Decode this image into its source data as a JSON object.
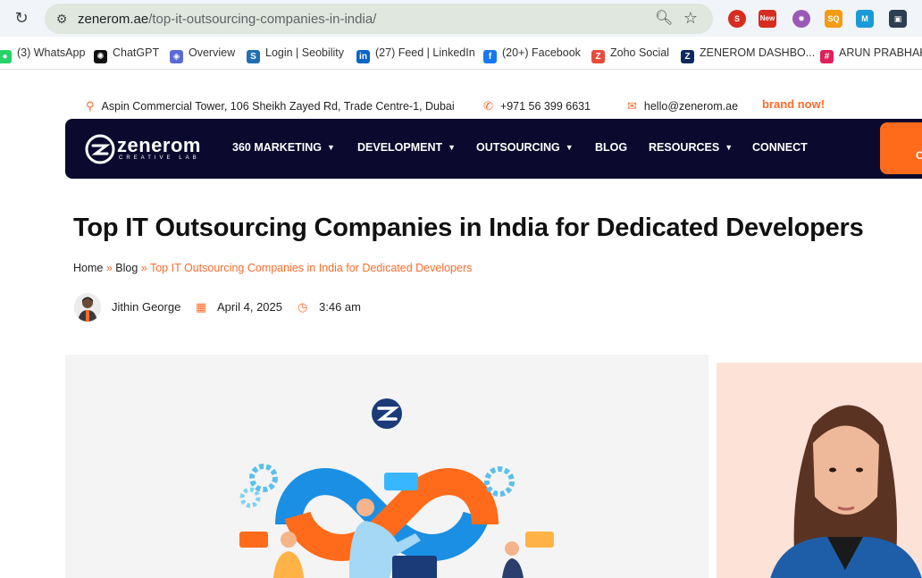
{
  "browser": {
    "url_host": "zenerom.ae",
    "url_path": "/top-it-outsourcing-companies-in-india/",
    "extensions": [
      {
        "name": "seo-extension-icon",
        "label": "SEO",
        "color": "#d62d20"
      },
      {
        "name": "new-extension-icon",
        "label": "New",
        "color": "#d62d20"
      },
      {
        "name": "gear-extension-icon",
        "label": "",
        "color": "#9b59b6"
      },
      {
        "name": "seoquake-extension-icon",
        "label": "SQ",
        "color": "#f39c12"
      },
      {
        "name": "m-extension-icon",
        "label": "M",
        "color": "#1a9bd7"
      },
      {
        "name": "puzzle-extension-icon",
        "label": "",
        "color": "#2c3e50"
      }
    ]
  },
  "bookmarks": [
    {
      "label": "(3) WhatsApp",
      "icon": "whatsapp-icon",
      "color": "#25d366",
      "glyph": "●"
    },
    {
      "label": "ChatGPT",
      "icon": "chatgpt-icon",
      "color": "#111111",
      "glyph": "✺"
    },
    {
      "label": "Overview",
      "icon": "overview-icon",
      "color": "#5b6bd6",
      "glyph": "◈"
    },
    {
      "label": "Login | Seobility",
      "icon": "seobility-icon",
      "color": "#1f6fb5",
      "glyph": "S"
    },
    {
      "label": "(27) Feed | LinkedIn",
      "icon": "linkedin-icon",
      "color": "#0a66c2",
      "glyph": "in"
    },
    {
      "label": "(20+) Facebook",
      "icon": "facebook-icon",
      "color": "#1877f2",
      "glyph": "f"
    },
    {
      "label": "Zoho Social",
      "icon": "zoho-icon",
      "color": "#e84b3c",
      "glyph": "Z"
    },
    {
      "label": "ZENEROM DASHBO...",
      "icon": "zenerom-icon",
      "color": "#0b2a5b",
      "glyph": "Z"
    },
    {
      "label": "ARUN PRABHAKA",
      "icon": "slack-icon",
      "color": "#e01e5a",
      "glyph": "#"
    }
  ],
  "topbar": {
    "address": "Aspin Commercial Tower, 106 Sheikh Zayed Rd, Trade Centre-1, Dubai",
    "phone": "+971 56 399 6631",
    "email": "hello@zenerom.ae",
    "brand_now": "brand now!"
  },
  "nav": {
    "logo_text": "zenerom",
    "logo_sub": "CREATIVE LAB",
    "items": [
      {
        "label": "360 MARKETING",
        "dropdown": true
      },
      {
        "label": "DEVELOPMENT",
        "dropdown": true
      },
      {
        "label": "OUTSOURCING",
        "dropdown": true
      },
      {
        "label": "BLOG",
        "dropdown": false
      },
      {
        "label": "RESOURCES",
        "dropdown": true
      },
      {
        "label": "CONNECT",
        "dropdown": false
      }
    ],
    "cta_label": "C"
  },
  "article": {
    "title": "Top IT Outsourcing Companies in India for Dedicated Developers",
    "breadcrumb": {
      "home": "Home",
      "blog": "Blog",
      "current": "Top IT Outsourcing Companies in India for Dedicated Developers",
      "separator": "»"
    },
    "author": "Jithin George",
    "date": "April 4, 2025",
    "time": "3:46 am"
  },
  "colors": {
    "accent": "#ff6b2b",
    "nav_bg": "#0b0a2e"
  }
}
